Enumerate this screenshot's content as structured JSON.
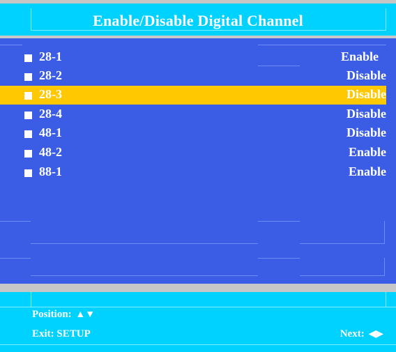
{
  "header": {
    "title": "Enable/Disable Digital Channel"
  },
  "channels": [
    {
      "label": "28-1",
      "value": "Enable"
    },
    {
      "label": "28-2",
      "value": "Disable"
    },
    {
      "label": "28-3",
      "value": "Disable",
      "selected": true
    },
    {
      "label": "28-4",
      "value": "Disable"
    },
    {
      "label": "48-1",
      "value": "Disable"
    },
    {
      "label": "48-2",
      "value": "Enable"
    },
    {
      "label": "88-1",
      "value": "Enable"
    }
  ],
  "footer": {
    "position_label": "Position:",
    "position_arrows": "▲▼",
    "exit_label": "Exit: SETUP",
    "next_label": "Next:",
    "next_arrows": "◀▶"
  },
  "colors": {
    "header_bg": "#00d2ff",
    "list_bg": "#3b5de6",
    "highlight": "#ffc800",
    "divider": "#c7c7c7"
  }
}
